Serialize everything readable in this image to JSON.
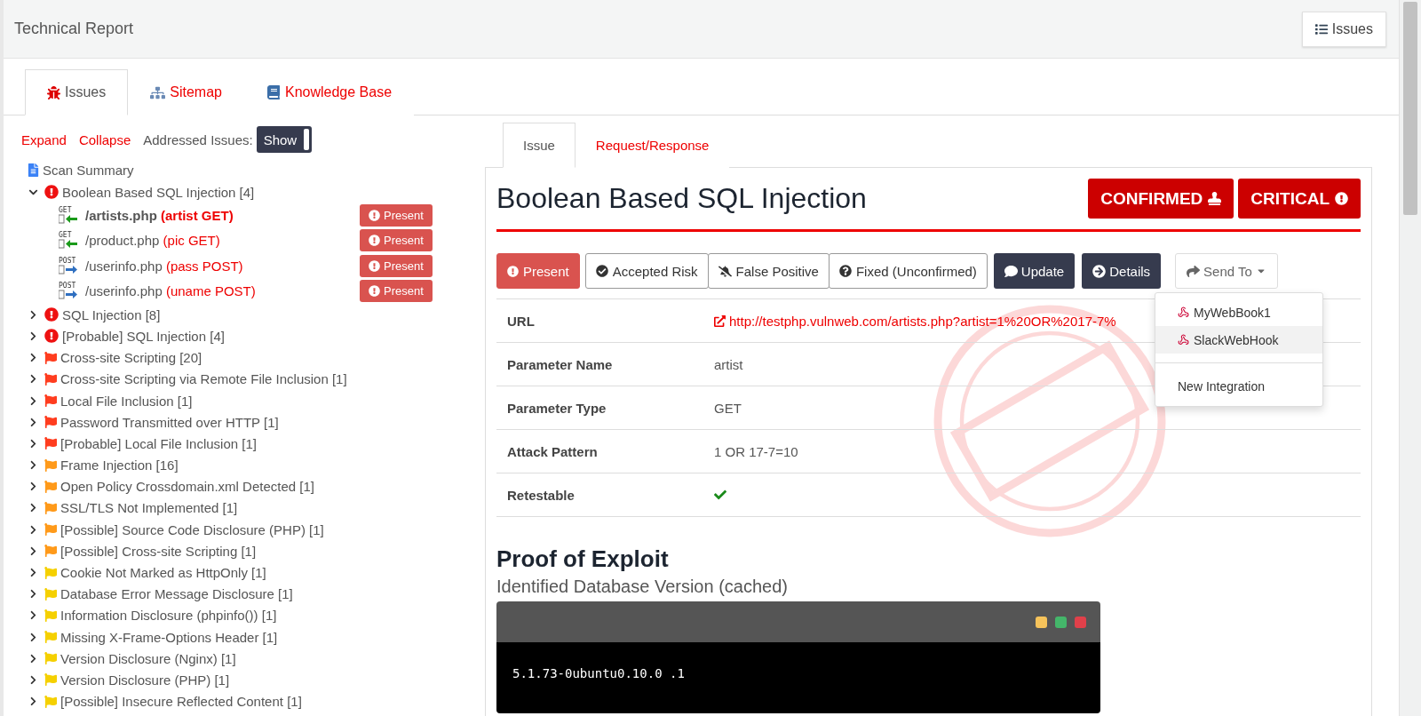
{
  "header": {
    "title": "Technical Report",
    "button": "Issues"
  },
  "main_tabs": [
    {
      "label": "Issues",
      "kind": "bug",
      "selected": true
    },
    {
      "label": "Sitemap",
      "kind": "sitemap",
      "selected": false
    },
    {
      "label": "Knowledge Base",
      "kind": "book",
      "selected": false
    }
  ],
  "toolbar": {
    "expand": "Expand",
    "collapse": "Collapse",
    "addressed_label": "Addressed Issues:",
    "addressed_toggle": "Show"
  },
  "scan_summary": "Scan Summary",
  "tree": [
    {
      "label": "Boolean Based SQL Injection [4]",
      "kind": "critical",
      "color": "#ee1111",
      "expanded": true,
      "children": [
        {
          "method": "GET",
          "path": "/artists.php",
          "param": "(artist GET)",
          "status": "Present",
          "selected": true
        },
        {
          "method": "GET",
          "path": "/product.php",
          "param": "(pic GET)",
          "status": "Present",
          "selected": false
        },
        {
          "method": "POST",
          "path": "/userinfo.php",
          "param": "(pass POST)",
          "status": "Present",
          "selected": false
        },
        {
          "method": "POST",
          "path": "/userinfo.php",
          "param": "(uname POST)",
          "status": "Present",
          "selected": false
        }
      ]
    },
    {
      "label": "SQL Injection [8]",
      "kind": "critical",
      "color": "#ee1111",
      "expanded": false
    },
    {
      "label": "[Probable] SQL Injection [4]",
      "kind": "critical",
      "color": "#ee1111",
      "expanded": false
    },
    {
      "label": "Cross-site Scripting [20]",
      "kind": "flag",
      "color": "#ff3d1f",
      "expanded": false
    },
    {
      "label": "Cross-site Scripting via Remote File Inclusion [1]",
      "kind": "flag",
      "color": "#ff3d1f",
      "expanded": false
    },
    {
      "label": "Local File Inclusion [1]",
      "kind": "flag",
      "color": "#ff3d1f",
      "expanded": false
    },
    {
      "label": "Password Transmitted over HTTP [1]",
      "kind": "flag",
      "color": "#ff3d1f",
      "expanded": false
    },
    {
      "label": "[Probable] Local File Inclusion [1]",
      "kind": "flag",
      "color": "#ff3d1f",
      "expanded": false
    },
    {
      "label": "Frame Injection [16]",
      "kind": "flag",
      "color": "#ff9a1a",
      "expanded": false
    },
    {
      "label": "Open Policy Crossdomain.xml Detected [1]",
      "kind": "flag",
      "color": "#ff9a1a",
      "expanded": false
    },
    {
      "label": "SSL/TLS Not Implemented [1]",
      "kind": "flag",
      "color": "#ff9a1a",
      "expanded": false
    },
    {
      "label": "[Possible] Source Code Disclosure (PHP) [1]",
      "kind": "flag",
      "color": "#ff9a1a",
      "expanded": false
    },
    {
      "label": "[Possible] Cross-site Scripting [1]",
      "kind": "flag",
      "color": "#ff9a1a",
      "expanded": false
    },
    {
      "label": "Cookie Not Marked as HttpOnly [1]",
      "kind": "flag",
      "color": "#f5d000",
      "expanded": false
    },
    {
      "label": "Database Error Message Disclosure [1]",
      "kind": "flag",
      "color": "#f5d000",
      "expanded": false
    },
    {
      "label": "Information Disclosure (phpinfo()) [1]",
      "kind": "flag",
      "color": "#f5d000",
      "expanded": false
    },
    {
      "label": "Missing X-Frame-Options Header [1]",
      "kind": "flag",
      "color": "#f5d000",
      "expanded": false
    },
    {
      "label": "Version Disclosure (Nginx) [1]",
      "kind": "flag",
      "color": "#f5d000",
      "expanded": false
    },
    {
      "label": "Version Disclosure (PHP) [1]",
      "kind": "flag",
      "color": "#f5d000",
      "expanded": false
    },
    {
      "label": "[Possible] Insecure Reflected Content [1]",
      "kind": "flag",
      "color": "#f5d000",
      "expanded": false
    }
  ],
  "detail_tabs": [
    {
      "label": "Issue",
      "selected": true
    },
    {
      "label": "Request/Response",
      "selected": false
    }
  ],
  "issue": {
    "title": "Boolean Based SQL Injection",
    "badges": [
      {
        "label": "CONFIRMED",
        "kind": "stamp"
      },
      {
        "label": "CRITICAL",
        "kind": "alert"
      }
    ],
    "status_buttons": [
      {
        "label": "Present",
        "kind": "present",
        "selected": true
      },
      {
        "label": "Accepted Risk",
        "kind": "accepted",
        "selected": false
      },
      {
        "label": "False Positive",
        "kind": "false_positive",
        "selected": false
      },
      {
        "label": "Fixed (Unconfirmed)",
        "kind": "fixed",
        "selected": false
      }
    ],
    "actions": [
      {
        "label": "Update",
        "kind": "comment"
      },
      {
        "label": "Details",
        "kind": "arrow"
      }
    ],
    "send_to": {
      "label": "Send To",
      "expanded": true,
      "integrations": [
        {
          "label": "MyWebBook1",
          "selected": false
        },
        {
          "label": "SlackWebHook",
          "selected": true
        }
      ],
      "new_integration": "New Integration"
    },
    "fields": [
      {
        "name": "URL",
        "kind": "link",
        "value": "http://testphp.vulnweb.com/artists.php?artist=1%20OR%2017-7%"
      },
      {
        "name": "Parameter Name",
        "kind": "text",
        "value": "artist"
      },
      {
        "name": "Parameter Type",
        "kind": "text",
        "value": "GET"
      },
      {
        "name": "Attack Pattern",
        "kind": "text",
        "value": "1 OR 17-7=10"
      },
      {
        "name": "Retestable",
        "kind": "check",
        "checked": true
      }
    ],
    "proof_title": "Proof of Exploit",
    "proof_subtitle": "Identified Database Version (cached)",
    "terminal_output": "5.1.73-0ubuntu0.10.0 .1"
  }
}
